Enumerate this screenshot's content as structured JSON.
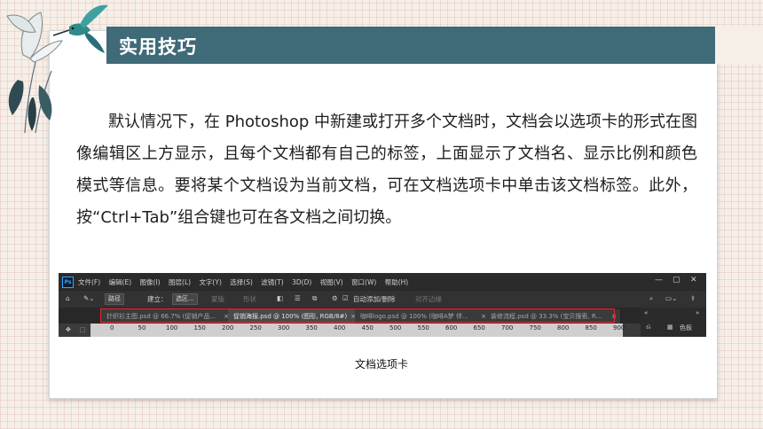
{
  "slide": {
    "title": "实用技巧",
    "paragraph": "默认情况下，在 Photoshop 中新建或打开多个文档时，文档会以选项卡的形式在图像编辑区上方显示，且每个文档都有自己的标签，上面显示了文档名、显示比例和颜色模式等信息。要将某个文档设为当前文档，可在文档选项卡中单击该文档标签。此外，按“Ctrl+Tab”组合键也可在各文档之间切换。",
    "caption": "文档选项卡"
  },
  "photoshop": {
    "logo": "Ps",
    "menus": [
      "文件(F)",
      "编辑(E)",
      "图像(I)",
      "图层(L)",
      "文字(Y)",
      "选择(S)",
      "滤镜(T)",
      "3D(D)",
      "视图(V)",
      "窗口(W)",
      "帮助(H)"
    ],
    "options": {
      "path_mode": "路径",
      "build_label": "建立：",
      "selection_btn": "选区...",
      "mask_btn": "蒙版",
      "shape_btn": "形状",
      "auto_add_label": "自动添加/删除",
      "align_edges": "对齐边缘"
    },
    "tabs": [
      {
        "label": "针织衫主图.psd @ 66.7% (促销产品...",
        "active": false
      },
      {
        "label": "促销海报.psd @ 100% (图形, RGB/8#)",
        "active": true
      },
      {
        "label": "咖啡logo.psd @ 100% (咖啡A梦 伴...",
        "active": false
      },
      {
        "label": "装修流程.psd @ 33.3% (宝贝搜索, R...",
        "active": false
      }
    ],
    "ruler_ticks": [
      "0",
      "50",
      "100",
      "150",
      "200",
      "250",
      "300",
      "350",
      "400",
      "450",
      "500",
      "550",
      "600",
      "650",
      "700",
      "750",
      "800",
      "850",
      "900"
    ],
    "panel_label": "色板"
  }
}
